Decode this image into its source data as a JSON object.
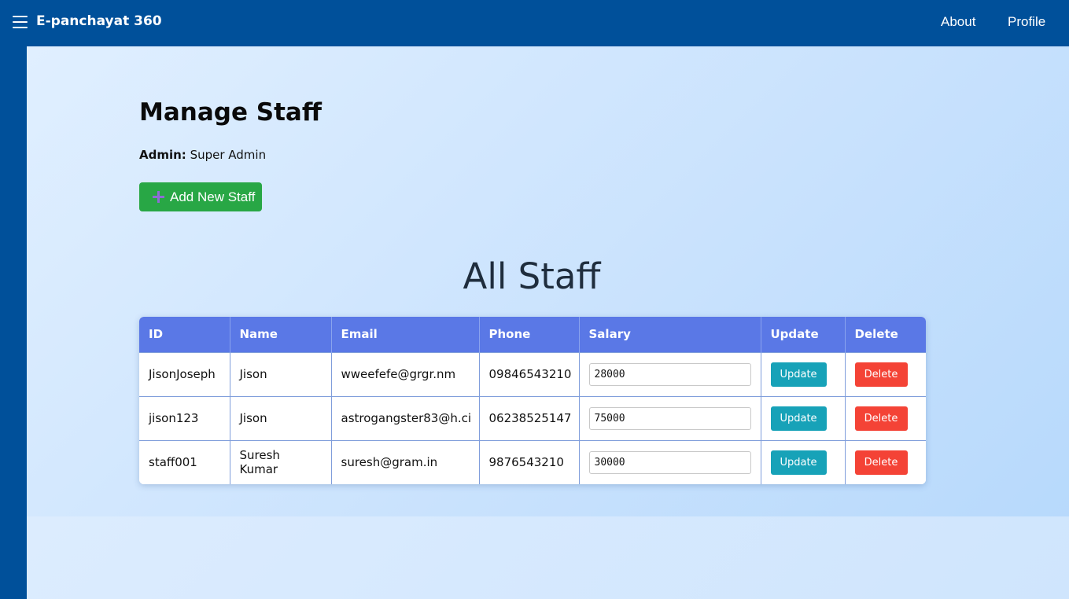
{
  "header": {
    "brand": "E-panchayat 360",
    "nav": {
      "about": "About",
      "profile": "Profile"
    }
  },
  "main": {
    "title": "Manage Staff",
    "admin_label": "Admin:",
    "admin_name": "Super Admin",
    "add_button": "Add New Staff",
    "section_title": "All Staff"
  },
  "table": {
    "columns": [
      "ID",
      "Name",
      "Email",
      "Phone",
      "Salary",
      "Update",
      "Delete"
    ],
    "rows": [
      {
        "id": "JisonJoseph",
        "name": "Jison",
        "email": "wweefefe@grgr.nm",
        "phone": "09846543210",
        "salary": "28000",
        "update_label": "Update",
        "delete_label": "Delete"
      },
      {
        "id": "jison123",
        "name": "Jison",
        "email": "astrogangster83@h.ci",
        "phone": "06238525147",
        "salary": "75000",
        "update_label": "Update",
        "delete_label": "Delete"
      },
      {
        "id": "staff001",
        "name": "Suresh Kumar",
        "email": "suresh@gram.in",
        "phone": "9876543210",
        "salary": "30000",
        "update_label": "Update",
        "delete_label": "Delete"
      }
    ]
  },
  "colors": {
    "navbar": "#00509a",
    "header_row": "#5a78e6",
    "add_button": "#28a745",
    "update_button": "#17a2b8",
    "delete_button": "#f44336"
  },
  "icons": {
    "menu": "hamburger-menu-icon",
    "add": "plus-icon"
  }
}
